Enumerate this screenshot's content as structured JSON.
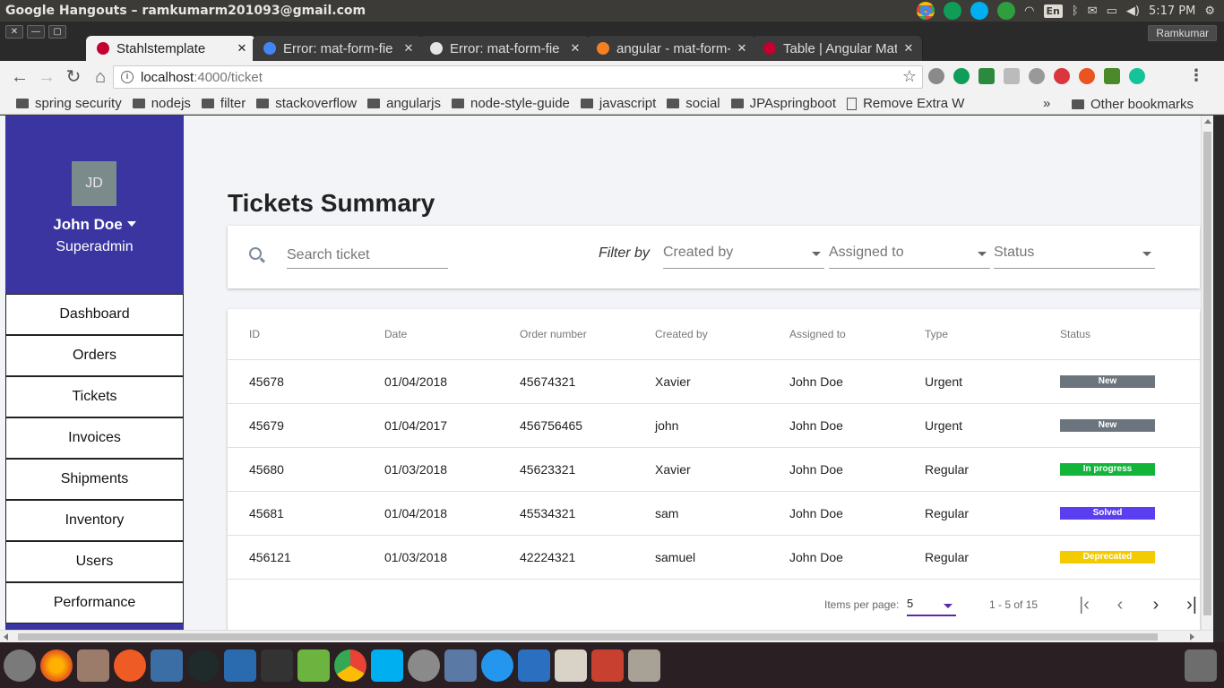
{
  "os": {
    "window_title": "Google Hangouts – ramkumarm201093@gmail.com",
    "keyboard_layout": "En",
    "clock": "5:17 PM"
  },
  "browser": {
    "profile_name": "Ramkumar",
    "tabs": [
      {
        "title": "Stahlstemplate",
        "favicon_color": "#c3002f",
        "active": true
      },
      {
        "title": "Error: mat-form-fie",
        "favicon_color": "#4285f4",
        "active": false
      },
      {
        "title": "Error: mat-form-fie",
        "favicon_color": "#e5e5e5",
        "active": false
      },
      {
        "title": "angular - mat-form-",
        "favicon_color": "#f48024",
        "active": false
      },
      {
        "title": "Table | Angular Mat",
        "favicon_color": "#c3002f",
        "active": false
      }
    ],
    "url_host": "localhost",
    "url_path": ":4000/ticket",
    "bookmarks": [
      {
        "label": "spring security",
        "type": "folder"
      },
      {
        "label": "nodejs",
        "type": "folder"
      },
      {
        "label": "filter",
        "type": "folder"
      },
      {
        "label": "stackoverflow",
        "type": "folder"
      },
      {
        "label": "angularjs",
        "type": "folder"
      },
      {
        "label": "node-style-guide",
        "type": "folder"
      },
      {
        "label": "javascript",
        "type": "folder"
      },
      {
        "label": "social",
        "type": "folder"
      },
      {
        "label": "JPAspringboot",
        "type": "folder"
      },
      {
        "label": "Remove Extra W",
        "type": "page"
      }
    ],
    "bookmarks_overflow": "»",
    "other_bookmarks": "Other bookmarks"
  },
  "sidebar": {
    "avatar_initials": "JD",
    "user_name": "John Doe",
    "user_role": "Superadmin",
    "items": [
      "Dashboard",
      "Orders",
      "Tickets",
      "Invoices",
      "Shipments",
      "Inventory",
      "Users",
      "Performance"
    ]
  },
  "main": {
    "title": "Tickets Summary",
    "search_placeholder": "Search ticket",
    "filter_label": "Filter by",
    "filters": [
      "Created by",
      "Assigned to",
      "Status"
    ],
    "columns": [
      "ID",
      "Date",
      "Order number",
      "Created by",
      "Assigned to",
      "Type",
      "Status"
    ],
    "rows": [
      {
        "id": "45678",
        "date": "01/04/2018",
        "order": "45674321",
        "created_by": "Xavier",
        "assigned_to": "John Doe",
        "type": "Urgent",
        "status": "New",
        "status_color": "#6c757d"
      },
      {
        "id": "45679",
        "date": "01/04/2017",
        "order": "456756465",
        "created_by": "john",
        "assigned_to": "John Doe",
        "type": "Urgent",
        "status": "New",
        "status_color": "#6c757d"
      },
      {
        "id": "45680",
        "date": "01/03/2018",
        "order": "45623321",
        "created_by": "Xavier",
        "assigned_to": "John Doe",
        "type": "Regular",
        "status": "In progress",
        "status_color": "#12b53a"
      },
      {
        "id": "45681",
        "date": "01/04/2018",
        "order": "45534321",
        "created_by": "sam",
        "assigned_to": "John Doe",
        "type": "Regular",
        "status": "Solved",
        "status_color": "#5a3ff0"
      },
      {
        "id": "456121",
        "date": "01/03/2018",
        "order": "42224321",
        "created_by": "samuel",
        "assigned_to": "John Doe",
        "type": "Regular",
        "status": "Deprecated",
        "status_color": "#f2cc00"
      }
    ],
    "paginator": {
      "items_per_page_label": "Items per page:",
      "items_per_page_value": "5",
      "range_label": "1 - 5 of 15"
    }
  },
  "colors": {
    "sidebar_bg": "#3a35a0",
    "accent": "#5b2aa7"
  }
}
